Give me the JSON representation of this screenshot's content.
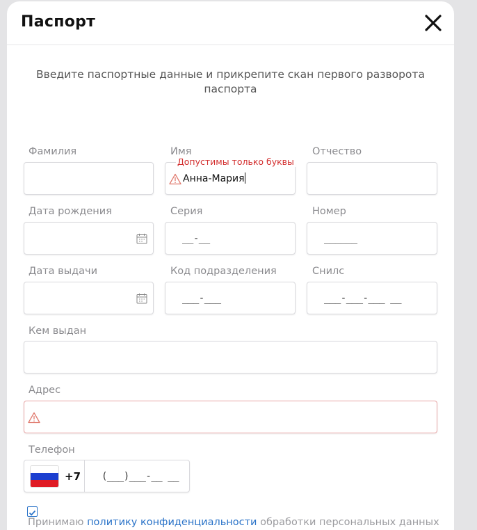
{
  "modal": {
    "title": "Паспорт",
    "intro": "Введите паспортные данные и прикрепите скан первого разворота паспорта"
  },
  "fields": {
    "last_name": {
      "label": "Фамилия",
      "value": ""
    },
    "first_name": {
      "label": "Имя",
      "value": "Анна-Мария",
      "error": "Допустимы только буквы"
    },
    "middle_name": {
      "label": "Отчество",
      "value": ""
    },
    "birth_date": {
      "label": "Дата рождения",
      "value": ""
    },
    "series": {
      "label": "Серия",
      "mask": "__-__"
    },
    "number": {
      "label": "Номер",
      "mask": "______"
    },
    "issue_date": {
      "label": "Дата выдачи",
      "value": ""
    },
    "division_code": {
      "label": "Код подразделения",
      "mask": "___-___"
    },
    "snils": {
      "label": "Снилс",
      "mask": "___-___-___ __"
    },
    "issued_by": {
      "label": "Кем выдан",
      "value": ""
    },
    "address": {
      "label": "Адрес",
      "value": ""
    },
    "phone": {
      "label": "Телефон",
      "country_code": "+7",
      "mask": "(___)___-__ __"
    }
  },
  "consent": {
    "checked": true,
    "prefix": "Принимаю ",
    "link": "политику конфиденциальности",
    "suffix": " обработки персональных данных"
  },
  "colors": {
    "error": "#d32f2f",
    "link": "#2a73c8",
    "flag": [
      "#ffffff",
      "#1c3fd0",
      "#e01b24"
    ]
  }
}
